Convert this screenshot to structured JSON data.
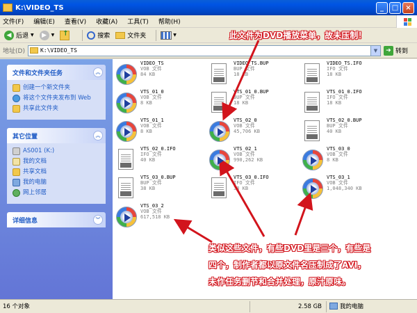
{
  "window": {
    "title": "K:\\VIDEO_TS",
    "minimize_label": "_",
    "maximize_label": "□",
    "close_label": "×"
  },
  "menu": [
    "文件(F)",
    "编辑(E)",
    "查看(V)",
    "收藏(A)",
    "工具(T)",
    "帮助(H)"
  ],
  "toolbar": {
    "back_label": "后退",
    "search_label": "搜索",
    "folders_label": "文件夹"
  },
  "address": {
    "label": "地址(D)",
    "value": "K:\\VIDEO_TS",
    "go_label": "转到"
  },
  "sidebar": {
    "file_tasks": {
      "title": "文件和文件夹任务",
      "items": [
        {
          "label": "创建一个新文件夹",
          "icon": "new-folder-icon"
        },
        {
          "label": "将这个文件夹发布到 Web",
          "icon": "publish-web-icon"
        },
        {
          "label": "共享此文件夹",
          "icon": "share-folder-icon"
        }
      ]
    },
    "other_places": {
      "title": "其它位置",
      "items": [
        {
          "label": "AS001 (K:)",
          "icon": "drive-icon"
        },
        {
          "label": "我的文档",
          "icon": "my-documents-icon"
        },
        {
          "label": "共享文档",
          "icon": "shared-documents-icon"
        },
        {
          "label": "我的电脑",
          "icon": "my-computer-icon"
        },
        {
          "label": "网上邻居",
          "icon": "network-places-icon"
        }
      ]
    },
    "details": {
      "title": "详细信息"
    }
  },
  "files": [
    {
      "name": "VIDEO_TS",
      "type": "VOB 文件",
      "size": "84 KB",
      "kind": "vob"
    },
    {
      "name": "VIDEO_TS.BUP",
      "type": "BUP 文件",
      "size": "18 KB",
      "kind": "ifo"
    },
    {
      "name": "VIDEO_TS.IFO",
      "type": "IFO 文件",
      "size": "18 KB",
      "kind": "ifo"
    },
    {
      "name": "VTS_01_0",
      "type": "VOB 文件",
      "size": "8 KB",
      "kind": "vob"
    },
    {
      "name": "VTS_01_0.BUP",
      "type": "BUP 文件",
      "size": "18 KB",
      "kind": "ifo"
    },
    {
      "name": "VTS_01_0.IFO",
      "type": "IFO 文件",
      "size": "18 KB",
      "kind": "ifo"
    },
    {
      "name": "VTS_01_1",
      "type": "VOB 文件",
      "size": "8 KB",
      "kind": "vob"
    },
    {
      "name": "VTS_02_0",
      "type": "VOB 文件",
      "size": "45,706 KB",
      "kind": "vob"
    },
    {
      "name": "VTS_02_0.BUP",
      "type": "BUP 文件",
      "size": "40 KB",
      "kind": "ifo"
    },
    {
      "name": "VTS_02_0.IFO",
      "type": "IFO 文件",
      "size": "40 KB",
      "kind": "ifo"
    },
    {
      "name": "VTS_02_1",
      "type": "VOB 文件",
      "size": "990,262 KB",
      "kind": "vob"
    },
    {
      "name": "VTS_03_0",
      "type": "VOB 文件",
      "size": "8 KB",
      "kind": "vob"
    },
    {
      "name": "VTS_03_0.BUP",
      "type": "BUP 文件",
      "size": "38 KB",
      "kind": "ifo"
    },
    {
      "name": "VTS_03_0.IFO",
      "type": "IFO 文件",
      "size": "38 KB",
      "kind": "ifo"
    },
    {
      "name": "VTS_03_1",
      "type": "VOB 文件",
      "size": "1,048,340 KB",
      "kind": "vob"
    },
    {
      "name": "VTS_03_2",
      "type": "VOB 文件",
      "size": "617,518 KB",
      "kind": "vob"
    }
  ],
  "status": {
    "count": "16 个对象",
    "size": "2.58 GB",
    "location": "我的电脑"
  },
  "annotations": {
    "top": "此文件为DVD播放菜单，故未压制！",
    "bottom_lines": [
      "类似这些文件，有些DVD里是三个，有些是",
      "四个，制作者都以原文件名压制成了AVI，",
      "未作任务删节和合并处理，原汁原味。"
    ]
  },
  "colors": {
    "annotation_red": "#D2141C",
    "titlebar_blue": "#0054E3",
    "sidebar_link": "#215DC6"
  }
}
